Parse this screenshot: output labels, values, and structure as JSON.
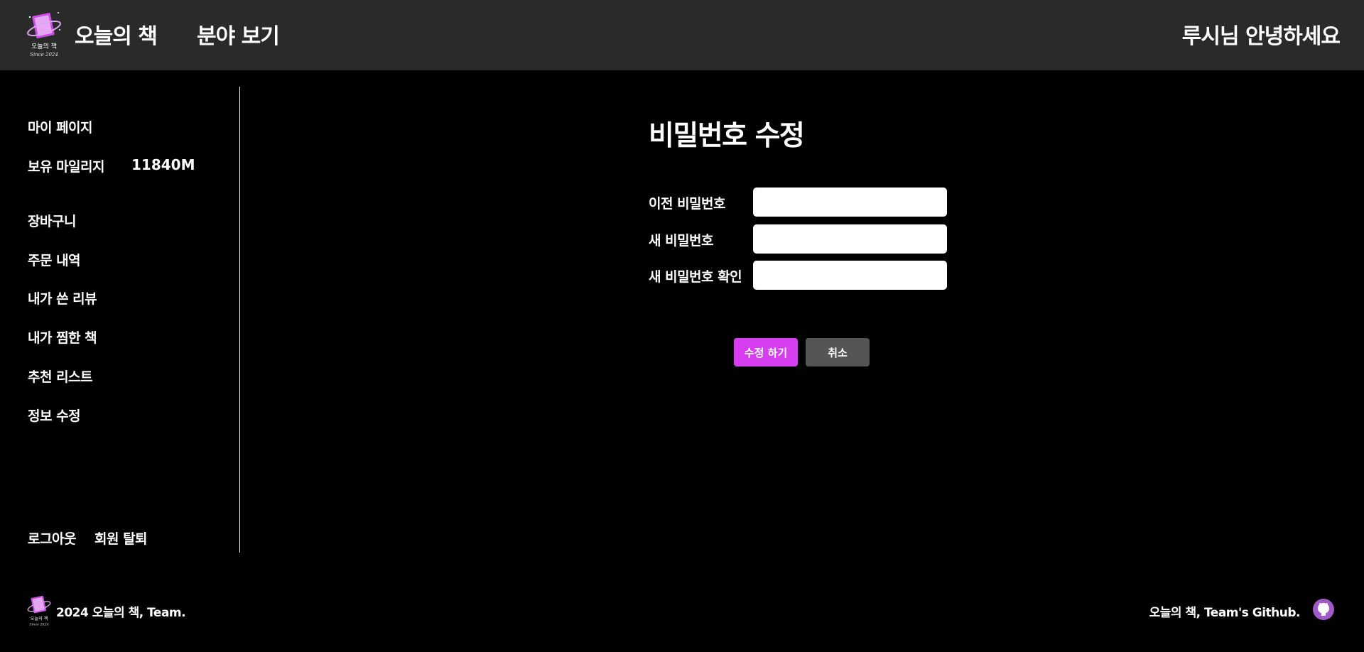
{
  "header": {
    "logo_text": "오늘의 책",
    "logo_sub": "Since 2024",
    "brand": "오늘의 책",
    "nav_genre": "분야 보기",
    "greeting": "루시님 안녕하세요"
  },
  "sidebar": {
    "my_page": "마이 페이지",
    "mileage_label": "보유 마일리지",
    "mileage_value": "11840M",
    "items": [
      {
        "label": "장바구니"
      },
      {
        "label": "주문 내역"
      },
      {
        "label": "내가 쓴 리뷰"
      },
      {
        "label": "내가 찜한 책"
      },
      {
        "label": "추천 리스트"
      },
      {
        "label": "정보 수정"
      }
    ],
    "logout": "로그아웃",
    "withdraw": "회원 탈퇴"
  },
  "form": {
    "title": "비밀번호 수정",
    "old_password_label": "이전 비밀번호",
    "new_password_label": "새 비밀번호",
    "confirm_password_label": "새 비밀번호 확인",
    "old_password_value": "",
    "new_password_value": "",
    "confirm_password_value": "",
    "submit_label": "수정 하기",
    "cancel_label": "취소"
  },
  "footer": {
    "copyright": "2024 오늘의 책, Team.",
    "github_text": "오늘의 책, Team's Github."
  },
  "colors": {
    "header_bg": "#2a2a2a",
    "page_bg": "#000000",
    "accent": "#d63ef0",
    "cancel_bg": "#555555",
    "github_icon": "#a259c9"
  },
  "icons": {
    "logo": "book-planet-logo-icon",
    "github": "github-icon"
  }
}
